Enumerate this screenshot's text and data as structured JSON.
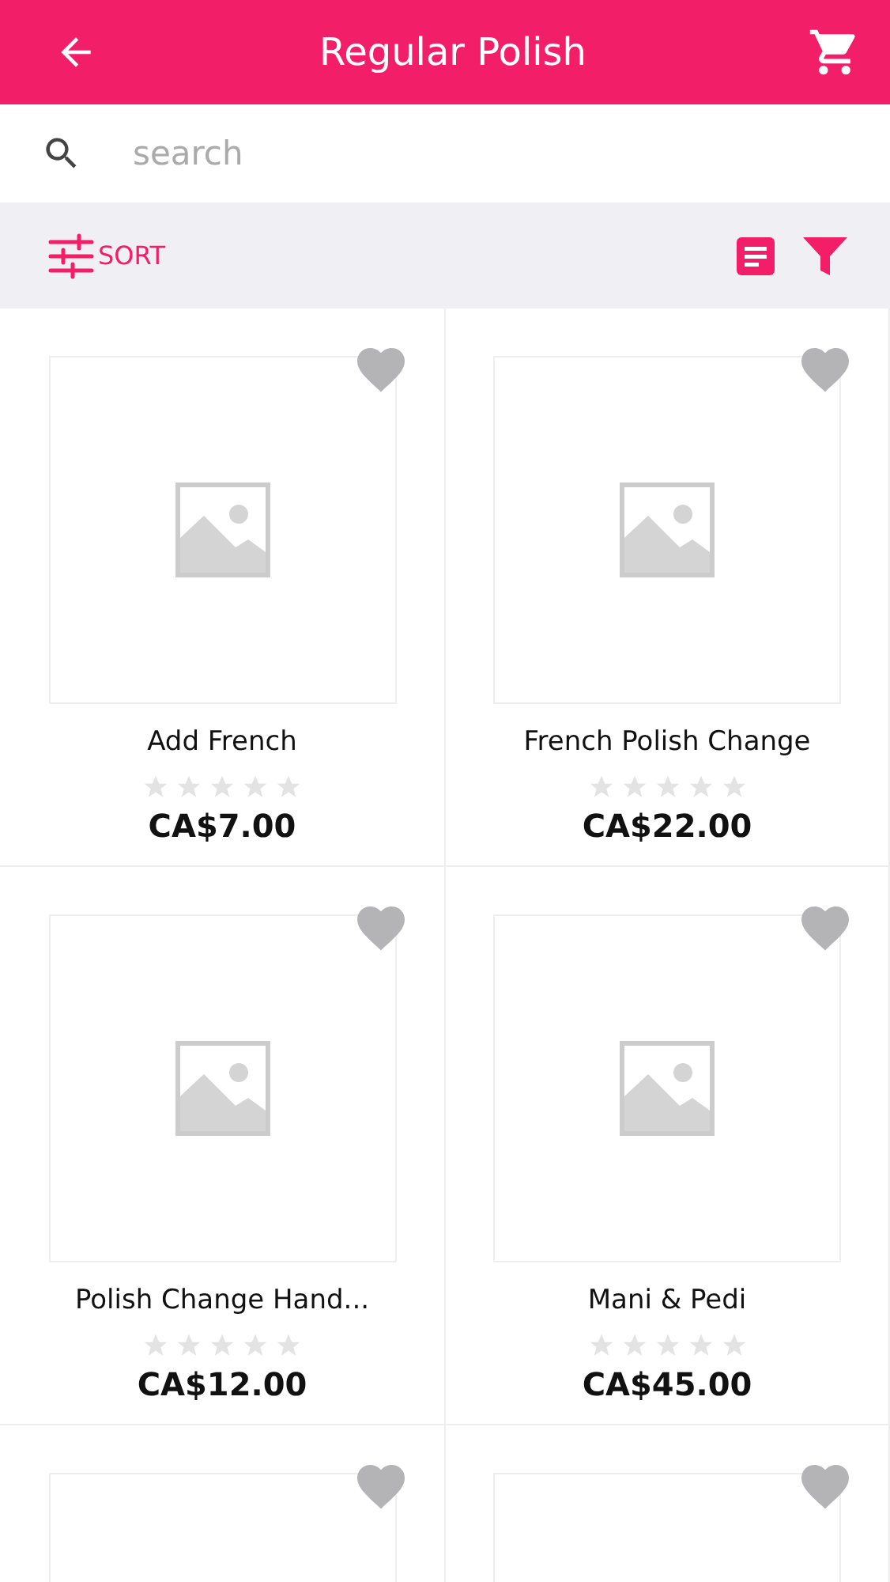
{
  "header": {
    "title": "Regular Polish"
  },
  "search": {
    "placeholder": "search"
  },
  "toolbar": {
    "sort_label": "SORT"
  },
  "products": [
    {
      "name": "Add French",
      "stars": 0,
      "price": "CA$7.00",
      "favorite": false
    },
    {
      "name": "French Polish Change",
      "stars": 0,
      "price": "CA$22.00",
      "favorite": false
    },
    {
      "name": "Polish Change Hand...",
      "stars": 0,
      "price": "CA$12.00",
      "favorite": false
    },
    {
      "name": "Mani & Pedi",
      "stars": 0,
      "price": "CA$45.00",
      "favorite": false
    },
    {
      "favorite": false
    },
    {
      "favorite": false
    }
  ]
}
